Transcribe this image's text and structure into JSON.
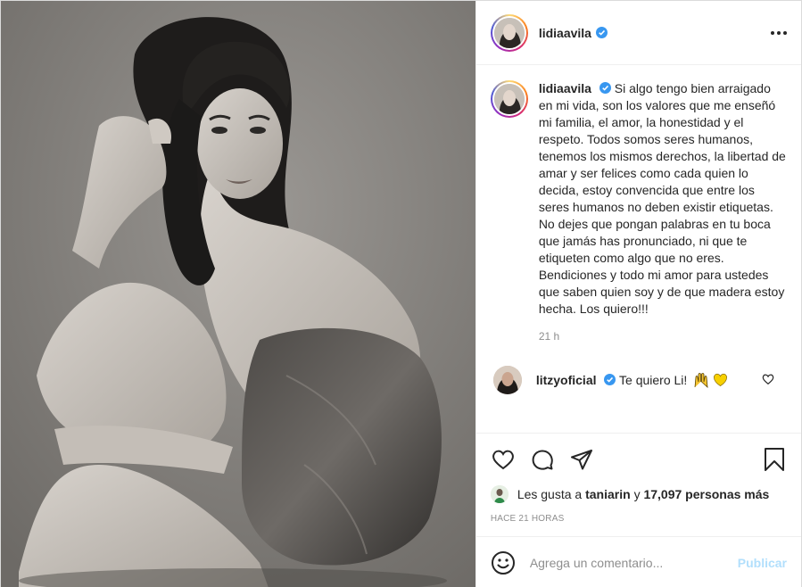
{
  "post": {
    "author": {
      "username": "lidiaavila",
      "verified": true
    },
    "photo_alt": "",
    "caption": {
      "username": "lidiaavila",
      "text": "Si algo tengo bien arraigado en mi vida, son los valores que me enseñó mi familia, el amor, la honestidad y el respeto. Todos somos seres humanos, tenemos los mismos derechos, la libertad de amar y ser felices como cada quien lo decida, estoy convencida que entre los seres humanos no deben existir etiquetas. No dejes que pongan palabras en tu boca que jamás has pronunciado, ni que te etiqueten como algo que no eres. Bendiciones y todo mi amor para ustedes que saben quien soy y de que madera estoy hecha. Los quiero!!!",
      "time": "21 h"
    },
    "comments": [
      {
        "username": "litzyoficial",
        "verified": true,
        "text": "Te quiero Li!"
      }
    ],
    "likes": {
      "prefix": "Les gusta a",
      "liker": "taniarin",
      "connector": "y",
      "count_text": "17,097 personas más"
    },
    "posted_ago": "HACE 21 HORAS",
    "add_comment": {
      "placeholder": "Agrega un comentario...",
      "publish_label": "Publicar"
    }
  },
  "icons": {
    "more": "more-options-icon",
    "like": "heart-icon",
    "comment": "comment-icon",
    "share": "share-icon",
    "save": "bookmark-icon",
    "emoji": "emoji-icon",
    "verified": "verified-badge-icon"
  },
  "colors": {
    "verified_blue": "#3897f0",
    "publish_disabled": "#b2dffc",
    "text_primary": "#262626",
    "text_secondary": "#8e8e8e"
  }
}
